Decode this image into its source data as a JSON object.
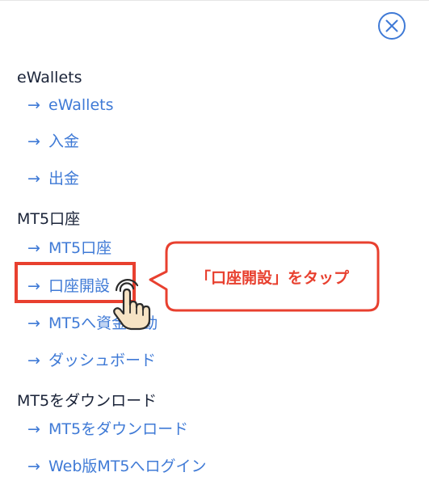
{
  "icons": {
    "close": "close-circle-icon",
    "arrow": "arrow-right-icon",
    "pointer": "tap-hand-icon"
  },
  "colors": {
    "link": "#3f7ad6",
    "heading": "#1a2338",
    "annotation": "#e8402f"
  },
  "menu": {
    "arrow_glyph": "→",
    "sections": [
      {
        "heading": "eWallets",
        "links": [
          "eWallets",
          "入金",
          "出金"
        ]
      },
      {
        "heading": "MT5口座",
        "links": [
          "MT5口座",
          "口座開設",
          "MT5へ資金移動",
          "ダッシュボード"
        ]
      },
      {
        "heading": "MT5をダウンロード",
        "links": [
          "MT5をダウンロード",
          "Web版MT5へログイン"
        ]
      }
    ]
  },
  "annotation": {
    "callout_text": "「口座開設」をタップ",
    "highlighted_item": "口座開設"
  }
}
